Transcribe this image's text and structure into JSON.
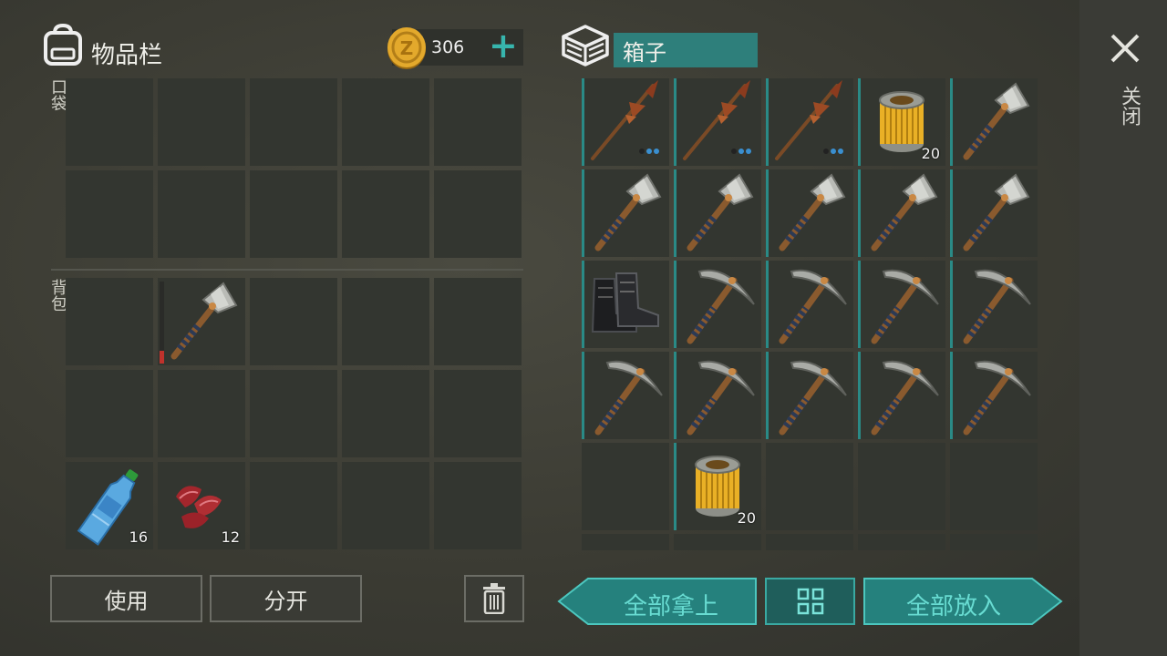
{
  "inventory": {
    "title": "物品栏",
    "pocket_label": "口袋",
    "backpack_label": "背包",
    "coins": "306",
    "add_symbol": "+",
    "pocket_slots": [
      {
        "item": "",
        "count": ""
      },
      {
        "item": "",
        "count": ""
      },
      {
        "item": "",
        "count": ""
      },
      {
        "item": "",
        "count": ""
      },
      {
        "item": "",
        "count": ""
      },
      {
        "item": "",
        "count": ""
      },
      {
        "item": "",
        "count": ""
      },
      {
        "item": "",
        "count": ""
      },
      {
        "item": "",
        "count": ""
      },
      {
        "item": "",
        "count": ""
      }
    ],
    "backpack_slots": [
      {
        "item": "",
        "count": ""
      },
      {
        "item": "hatchet-icon",
        "count": ""
      },
      {
        "item": "",
        "count": ""
      },
      {
        "item": "",
        "count": ""
      },
      {
        "item": "",
        "count": ""
      },
      {
        "item": "",
        "count": ""
      },
      {
        "item": "",
        "count": ""
      },
      {
        "item": "",
        "count": ""
      },
      {
        "item": "",
        "count": ""
      },
      {
        "item": "",
        "count": ""
      },
      {
        "item": "water-bottle-icon",
        "count": "16"
      },
      {
        "item": "raw-meat-icon",
        "count": "12"
      },
      {
        "item": "",
        "count": ""
      },
      {
        "item": "",
        "count": ""
      },
      {
        "item": "",
        "count": ""
      }
    ],
    "use_button": "使用",
    "split_button": "分开"
  },
  "chest": {
    "title": "箱子",
    "slots": [
      {
        "item": "spear-icon",
        "count": ""
      },
      {
        "item": "spear-icon",
        "count": ""
      },
      {
        "item": "spear-icon",
        "count": ""
      },
      {
        "item": "filter-icon",
        "count": "20"
      },
      {
        "item": "hatchet-icon",
        "count": ""
      },
      {
        "item": "hatchet-icon",
        "count": ""
      },
      {
        "item": "hatchet-icon",
        "count": ""
      },
      {
        "item": "hatchet-icon",
        "count": ""
      },
      {
        "item": "hatchet-icon",
        "count": ""
      },
      {
        "item": "hatchet-icon",
        "count": ""
      },
      {
        "item": "boots-icon",
        "count": ""
      },
      {
        "item": "pickaxe-icon",
        "count": ""
      },
      {
        "item": "pickaxe-icon",
        "count": ""
      },
      {
        "item": "pickaxe-icon",
        "count": ""
      },
      {
        "item": "pickaxe-icon",
        "count": ""
      },
      {
        "item": "pickaxe-icon",
        "count": ""
      },
      {
        "item": "pickaxe-icon",
        "count": ""
      },
      {
        "item": "pickaxe-icon",
        "count": ""
      },
      {
        "item": "pickaxe-icon",
        "count": ""
      },
      {
        "item": "pickaxe-icon",
        "count": ""
      },
      {
        "item": "",
        "count": ""
      },
      {
        "item": "filter-icon",
        "count": "20"
      },
      {
        "item": "",
        "count": ""
      },
      {
        "item": "",
        "count": ""
      },
      {
        "item": "",
        "count": ""
      }
    ],
    "take_all_button": "全部拿上",
    "put_all_button": "全部放入",
    "accent_color": "#2e9c97"
  },
  "close_label": "关闭"
}
